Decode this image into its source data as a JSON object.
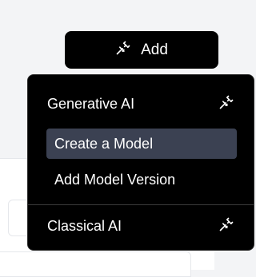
{
  "add_button": {
    "label": "Add",
    "icon": "plug-icon"
  },
  "menu": {
    "sections": [
      {
        "label": "Generative AI",
        "icon": "plug-icon",
        "items": [
          {
            "label": "Create a Model",
            "highlighted": true
          },
          {
            "label": "Add Model Version",
            "highlighted": false
          }
        ]
      },
      {
        "label": "Classical AI",
        "icon": "plug-icon",
        "items": []
      }
    ]
  },
  "colors": {
    "menu_bg": "#000000",
    "highlight": "#3b4152",
    "page_bg": "#f3f4f6"
  }
}
